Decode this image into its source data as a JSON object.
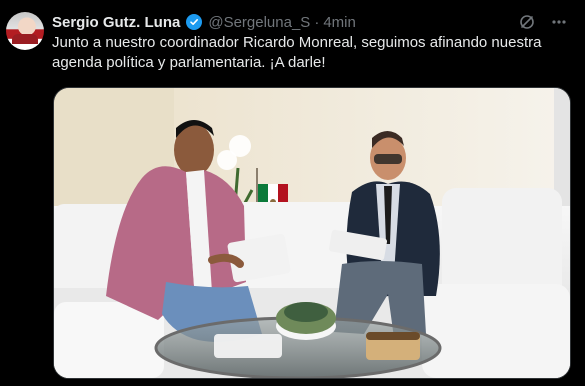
{
  "author": {
    "name": "Sergio Gutz. Luna",
    "handle": "@Sergeluna_S",
    "time": "4min"
  },
  "tweet": {
    "text": "Junto a nuestro coordinador Ricardo Monreal, seguimos afinando nuestra agenda política y parlamentaria. ¡A darle!"
  },
  "icons": {
    "verified": "verified-badge-icon",
    "grok": "grok-icon",
    "more": "more-icon"
  },
  "colors": {
    "background": "#000000",
    "text": "#e7e9ea",
    "muted": "#71767b",
    "accent": "#1d9bf0",
    "border": "#2f3336"
  }
}
